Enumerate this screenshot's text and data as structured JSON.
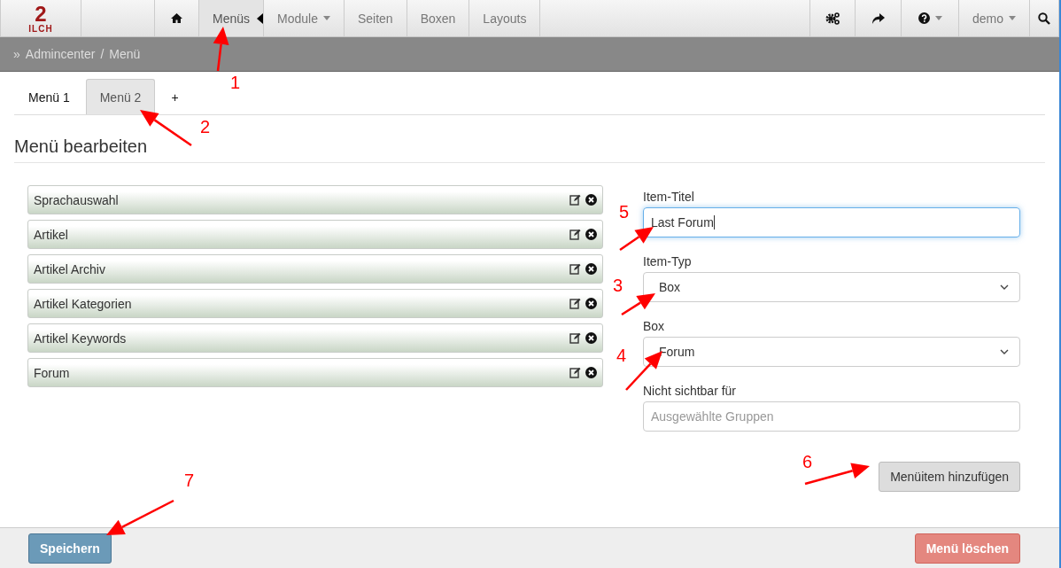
{
  "logo": {
    "number": "2",
    "word": "ILCH"
  },
  "nav": [
    {
      "kind": "home",
      "selected": false
    },
    {
      "kind": "link",
      "label": "Menüs",
      "selected": true
    },
    {
      "kind": "dropdown",
      "label": "Module",
      "selected": false
    },
    {
      "kind": "link",
      "label": "Seiten",
      "selected": false
    },
    {
      "kind": "link",
      "label": "Boxen",
      "selected": false
    },
    {
      "kind": "link",
      "label": "Layouts",
      "selected": false
    }
  ],
  "nav_right": [
    {
      "kind": "gears"
    },
    {
      "kind": "share"
    },
    {
      "kind": "help"
    },
    {
      "kind": "user",
      "label": "demo"
    },
    {
      "kind": "search"
    }
  ],
  "breadcrumb": {
    "prefix": "»",
    "items": [
      "Admincenter",
      "Menü"
    ],
    "separator": "/"
  },
  "tabs": [
    {
      "label": "Menü 1",
      "selected": false
    },
    {
      "label": "Menü 2",
      "selected": true
    },
    {
      "label": "+",
      "selected": false
    }
  ],
  "heading": "Menü bearbeiten",
  "menu_items": [
    "Sprachauswahl",
    "Artikel",
    "Artikel Archiv",
    "Artikel Kategorien",
    "Artikel Keywords",
    "Forum"
  ],
  "form": [
    {
      "kind": "input",
      "label": "Item-Titel",
      "value": "Last Forum",
      "focused": true
    },
    {
      "kind": "select",
      "label": "Item-Typ",
      "value": "Box"
    },
    {
      "kind": "select",
      "label": "Box",
      "value": "Forum"
    },
    {
      "kind": "input",
      "label": "Nicht sichtbar für",
      "placeholder": "Ausgewählte Gruppen",
      "focused": false
    }
  ],
  "add_button": "Menüitem hinzufügen",
  "footer": {
    "save": "Speichern",
    "delete": "Menü löschen"
  },
  "annotations": [
    "1",
    "2",
    "5",
    "3",
    "4",
    "6",
    "7"
  ]
}
